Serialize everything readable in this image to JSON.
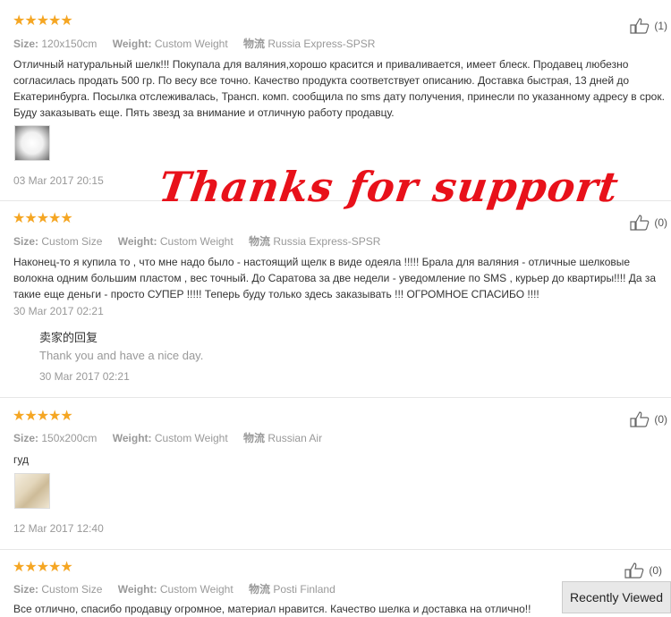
{
  "reviews": [
    {
      "rating": "★★★★★",
      "size_label": "Size:",
      "size": "120x150cm",
      "weight_label": "Weight:",
      "weight": "Custom Weight",
      "ship_label": "物流",
      "ship": "Russia Express-SPSR",
      "likes": "(1)",
      "text": "Отличный натуральный шелк!!! Покупала для валяния,хорошо красится и приваливается, имеет блеск. Продавец любезно согласилась продать 500 гр. По весу все точно. Качество продукта соответствует описанию. Доставка быстрая, 13 дней до Екатеринбурга. Посылка отслеживалась, Трансп. комп. сообщила по sms дату получения, принесли по указанному адресу в срок. Буду заказывать еще. Пять звезд за внимание и отличную работу продавцу.",
      "date": "03 Mar 2017 20:15"
    },
    {
      "rating": "★★★★★",
      "size_label": "Size:",
      "size": "Custom Size",
      "weight_label": "Weight:",
      "weight": "Custom Weight",
      "ship_label": "物流",
      "ship": "Russia Express-SPSR",
      "likes": "(0)",
      "text": "Наконец-то я купила то , что мне надо было - настоящий щелк в виде одеяла !!!!! Брала для валяния - отличные шелковые волокна одним большим пластом , вес точный. До Саратова за две недели - уведомление по SMS , курьер до квартиры!!!! Да за такие еще деньги - просто СУПЕР !!!!! Теперь буду только здесь заказывать !!! ОГРОМНОЕ СПАСИБО !!!!",
      "date": "30 Mar 2017 02:21",
      "reply": {
        "title": "卖家的回复",
        "text": "Thank you and have a nice day.",
        "date": "30 Mar 2017 02:21"
      }
    },
    {
      "rating": "★★★★★",
      "size_label": "Size:",
      "size": "150x200cm",
      "weight_label": "Weight:",
      "weight": "Custom Weight",
      "ship_label": "物流",
      "ship": "Russian Air",
      "likes": "(0)",
      "text": "гуд",
      "date": "12 Mar 2017 12:40"
    },
    {
      "rating": "★★★★★",
      "size_label": "Size:",
      "size": "Custom Size",
      "weight_label": "Weight:",
      "weight": "Custom Weight",
      "ship_label": "物流",
      "ship": "Posti Finland",
      "likes": "(0)",
      "text": "Все отлично, спасибо продавцу огромное, материал нравится. Качество шелка и доставка на отлично!!"
    }
  ],
  "watermark": "Thanks for support",
  "recently_viewed": "Recently Viewed",
  "colors": {
    "star": "#f5a623",
    "watermark": "#e8111a"
  },
  "icons": {
    "like": "thumbs-up-icon"
  }
}
